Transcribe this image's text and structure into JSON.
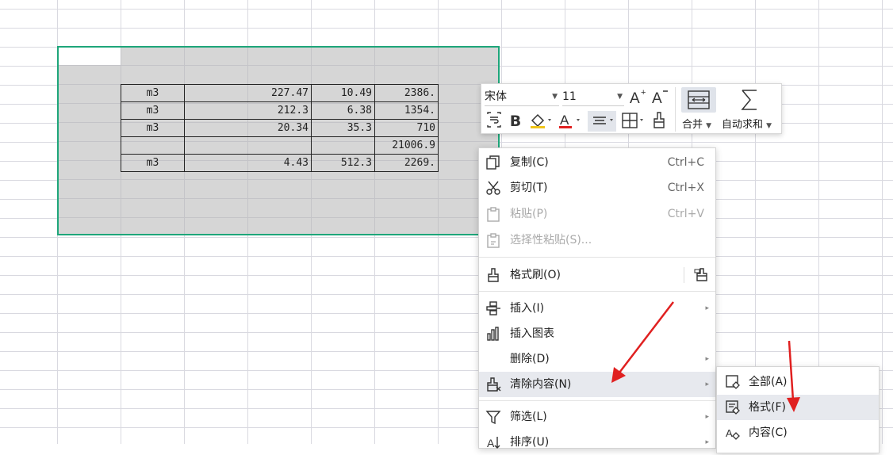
{
  "sheet": {
    "rows": [
      {
        "unit": "m3",
        "v1": "227.47",
        "v2": "10.49",
        "v3": "2386."
      },
      {
        "unit": "m3",
        "v1": "212.3",
        "v2": "6.38",
        "v3": "1354."
      },
      {
        "unit": "m3",
        "v1": "20.34",
        "v2": "35.3",
        "v3": "710"
      },
      {
        "unit": "",
        "v1": "",
        "v2": "",
        "v3": "21006.9"
      },
      {
        "unit": "m3",
        "v1": "4.43",
        "v2": "512.3",
        "v3": "2269."
      }
    ]
  },
  "mini_toolbar": {
    "font_name": "宋体",
    "font_size": "11",
    "merge_label": "合并",
    "autosum_label": "自动求和",
    "font_color": "#e02020",
    "fill_color": "#f0c419"
  },
  "context_menu": {
    "items": [
      {
        "label": "复制(C)",
        "shortcut": "Ctrl+C",
        "icon": "copy-icon"
      },
      {
        "label": "剪切(T)",
        "shortcut": "Ctrl+X",
        "icon": "cut-icon"
      },
      {
        "label": "粘贴(P)",
        "shortcut": "Ctrl+V",
        "icon": "paste-icon",
        "disabled": true
      },
      {
        "label": "选择性粘贴(S)...",
        "icon": "paste-special-icon",
        "disabled": true
      },
      {
        "label": "格式刷(O)",
        "icon": "format-painter-icon"
      },
      {
        "label": "插入(I)",
        "icon": "insert-icon"
      },
      {
        "label": "插入图表",
        "icon": "chart-icon"
      },
      {
        "label": "删除(D)",
        "icon": ""
      },
      {
        "label": "清除内容(N)",
        "icon": "clear-icon",
        "highlighted": true
      },
      {
        "label": "筛选(L)",
        "icon": "filter-icon"
      },
      {
        "label": "排序(U)",
        "icon": "sort-icon"
      }
    ]
  },
  "submenu": {
    "items": [
      {
        "label": "全部(A)",
        "icon": "clear-all-icon"
      },
      {
        "label": "格式(F)",
        "icon": "clear-format-icon",
        "highlighted": true
      },
      {
        "label": "内容(C)",
        "icon": "clear-content-icon"
      }
    ]
  },
  "accent_colors": {
    "selection_border": "#1ea67a",
    "annotation_arrow": "#e02020"
  }
}
